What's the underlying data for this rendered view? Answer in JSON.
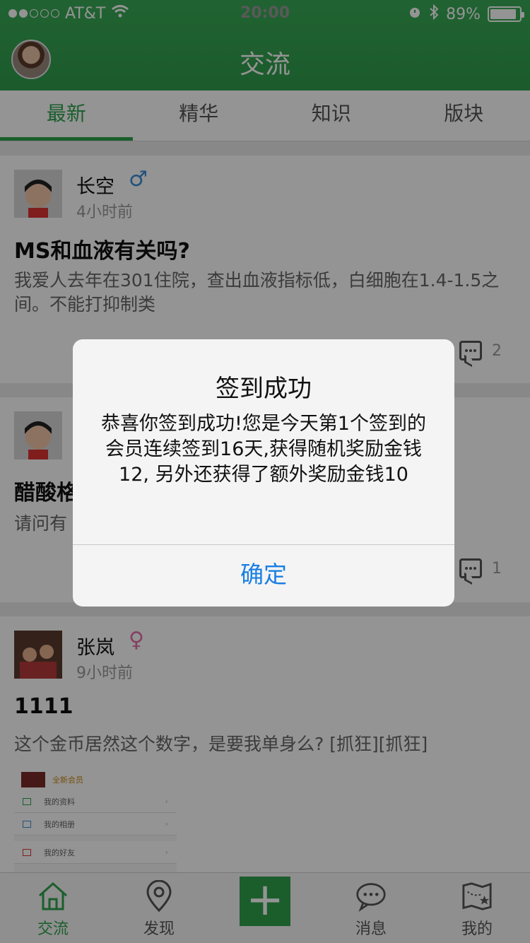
{
  "status_bar": {
    "carrier": "AT&T",
    "time": "20:00",
    "battery": "89%",
    "battery_level": 0.89,
    "signal_bars_filled": 2
  },
  "nav": {
    "title": "交流"
  },
  "tabs": [
    {
      "label": "最新",
      "active": true
    },
    {
      "label": "精华",
      "active": false
    },
    {
      "label": "知识",
      "active": false
    },
    {
      "label": "版块",
      "active": false
    }
  ],
  "posts": [
    {
      "author": "长空",
      "gender": "male",
      "gender_symbol": "♂",
      "time": "4小时前",
      "title": "MS和血液有关吗?",
      "body": "我爱人去年在301住院，查出血液指标低，白细胞在1.4-1.5之间。不能打抑制类",
      "comments": "2"
    },
    {
      "author": "",
      "title": "醋酸格",
      "body": "请问有",
      "comments": "1"
    },
    {
      "author": "张岚",
      "gender": "female",
      "gender_symbol": "♀",
      "time": "9小时前",
      "title": "1111",
      "body": "这个金币居然这个数字，是要我单身么?  [抓狂][抓狂]",
      "screenshot_rows": [
        "我的资料",
        "我的相册",
        "我的好友"
      ],
      "screenshot_tag": "全新会员"
    }
  ],
  "tabbar": [
    {
      "label": "交流",
      "icon": "home-icon",
      "active": true
    },
    {
      "label": "发现",
      "icon": "location-pin-icon",
      "active": false
    },
    {
      "label": "",
      "icon": "plus-icon",
      "active": false
    },
    {
      "label": "消息",
      "icon": "chat-bubble-icon",
      "active": false
    },
    {
      "label": "我的",
      "icon": "map-star-icon",
      "active": false
    }
  ],
  "alert": {
    "title": "签到成功",
    "message": "恭喜你签到成功!您是今天第1个签到的会员连续签到16天,获得随机奖励金钱12, 另外还获得了额外奖励金钱10",
    "button": "确定"
  },
  "colors": {
    "brand_green": "#2fa24d",
    "alert_button_blue": "#1a7fe2",
    "male_blue": "#3a8ed8",
    "female_pink": "#e36fa9"
  }
}
